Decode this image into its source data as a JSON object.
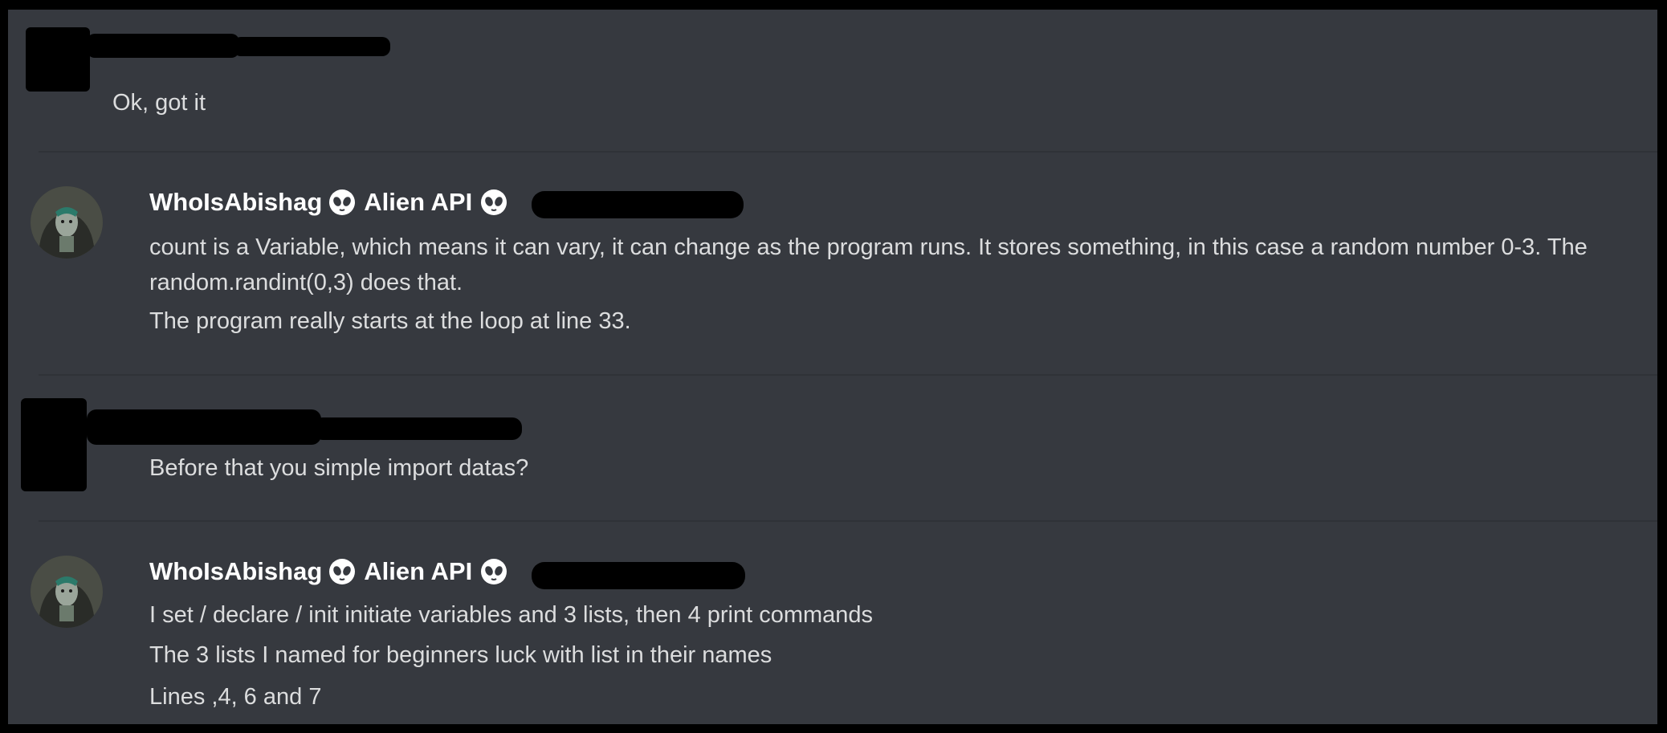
{
  "messages": [
    {
      "author": "",
      "redacted_author": true,
      "lines": [
        "Ok, got it"
      ]
    },
    {
      "author": "WhoIsAbishag",
      "role": "Alien API",
      "role_icon": "alien-emoji-icon",
      "lines": [
        "count is a Variable, which means it can vary, it can change as the program runs. It stores something, in this case a random number 0-3. The random.randint(0,3) does that.",
        "The program really starts at the loop at line 33."
      ]
    },
    {
      "author": "",
      "redacted_author": true,
      "lines": [
        "Before that you simple import datas?"
      ]
    },
    {
      "author": "WhoIsAbishag",
      "role": "Alien API",
      "role_icon": "alien-emoji-icon",
      "lines": [
        "I set / declare / init initiate variables and 3 lists, then 4 print commands",
        "The 3 lists I named for beginners luck with list in their names",
        "Lines ,4, 6 and 7"
      ]
    }
  ],
  "colors": {
    "background": "#36393f",
    "frame": "#000000",
    "text": "#dcddde",
    "username": "#ffffff",
    "divider": "#2f3237"
  }
}
